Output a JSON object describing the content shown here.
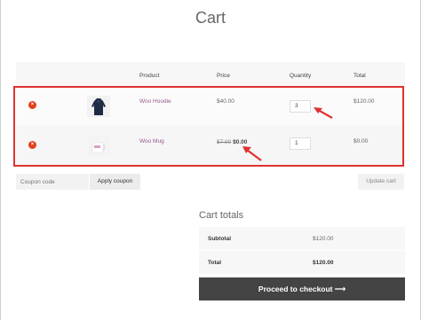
{
  "page": {
    "title": "Cart"
  },
  "table": {
    "headers": {
      "product": "Product",
      "price": "Price",
      "quantity": "Quantity",
      "total": "Total"
    },
    "rows": [
      {
        "name": "Woo Hoodie",
        "price": "$40.00",
        "quantity": "3",
        "total": "$120.00"
      },
      {
        "name": "Woo Mug",
        "price_old": "$7.00",
        "price_new": "$0.00",
        "quantity": "1",
        "total": "$0.00"
      }
    ]
  },
  "actions": {
    "coupon_placeholder": "Coupon code",
    "apply_label": "Apply coupon",
    "update_label": "Update cart"
  },
  "totals": {
    "title": "Cart totals",
    "subtotal_label": "Subtotal",
    "subtotal_value": "$120.00",
    "total_label": "Total",
    "total_value": "$120.00",
    "checkout_label": "Proceed to checkout",
    "checkout_arrow": "⟶"
  },
  "colors": {
    "remove": "#e2401c",
    "product_link": "#96588a",
    "highlight": "#e03131",
    "checkout_bg": "#444444"
  }
}
